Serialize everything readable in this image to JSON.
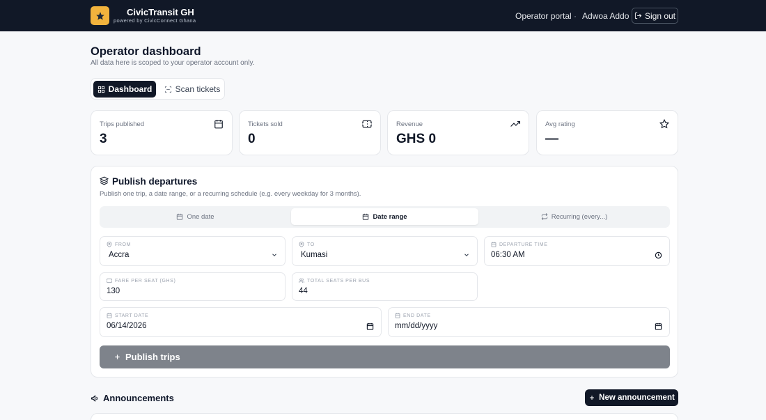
{
  "header": {
    "brand_name": "CivicTransit GH",
    "brand_tagline": "powered by CivicConnect Ghana",
    "nav_portal": "Operator portal",
    "separator": "·",
    "user_name": "Adwoa Addo",
    "sign_out": "Sign out",
    "logo_color": "#f2b33d"
  },
  "page": {
    "title": "Operator dashboard",
    "subtitle": "All data here is scoped to your operator account only."
  },
  "tabs": [
    {
      "label": "Dashboard",
      "icon": "grid-icon",
      "active": true
    },
    {
      "label": "Scan tickets",
      "icon": "scan-icon",
      "active": false
    }
  ],
  "stats": [
    {
      "label": "Trips published",
      "value": "3",
      "icon": "calendar-icon"
    },
    {
      "label": "Tickets sold",
      "value": "0",
      "icon": "ticket-icon"
    },
    {
      "label": "Revenue",
      "value": "GHS 0",
      "icon": "trending-up-icon"
    },
    {
      "label": "Avg rating",
      "value": "—",
      "icon": "star-icon"
    }
  ],
  "publish": {
    "title": "Publish departures",
    "subtitle": "Publish one trip, a date range, or a recurring schedule (e.g. every weekday for 3 months).",
    "modes": [
      {
        "label": "One date",
        "active": false
      },
      {
        "label": "Date range",
        "active": true
      },
      {
        "label": "Recurring (every...)",
        "active": false
      }
    ],
    "from_label": "FROM",
    "from_value": "Accra",
    "to_label": "TO",
    "to_value": "Kumasi",
    "departure_label": "DEPARTURE TIME",
    "departure_value": "06:30 AM",
    "fare_label": "FARE PER SEAT (GHS)",
    "fare_value": "130",
    "seats_label": "TOTAL SEATS PER BUS",
    "seats_value": "44",
    "start_label": "START DATE",
    "start_value": "06/14/2026",
    "end_label": "END DATE",
    "end_value": "mm/dd/yyyy",
    "button": "Publish trips"
  },
  "announcements": {
    "title": "Announcements",
    "new_button": "New announcement"
  },
  "colors": {
    "topbar": "#111827",
    "accent_dark": "#111827",
    "publish_button_disabled": "#7e838b"
  }
}
